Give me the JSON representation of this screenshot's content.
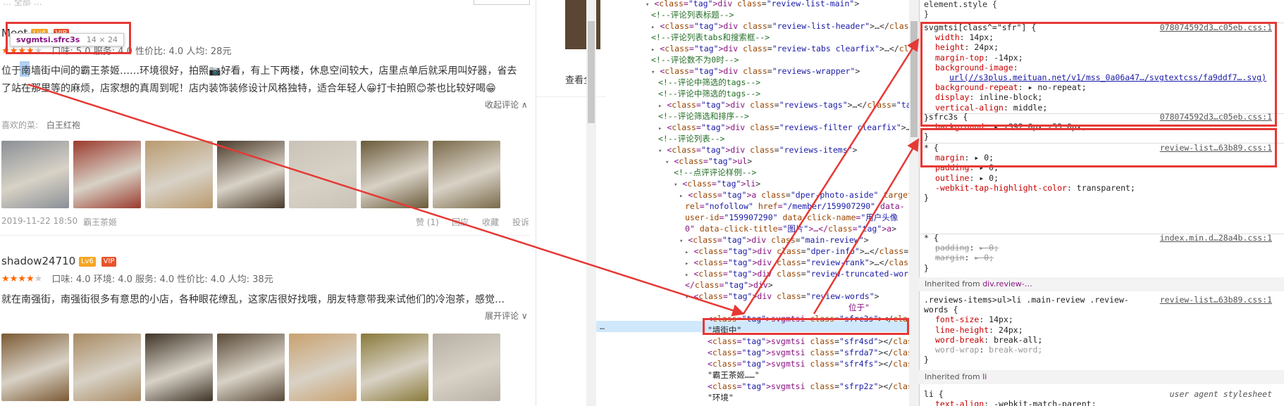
{
  "left": {
    "top_hint": "… 全部 …",
    "tooltip": {
      "name": "svgmtsi.sfrc3s",
      "size": "14 × 24"
    },
    "review1": {
      "user": "Meet",
      "level": "Lv4",
      "vip": "VIP",
      "scores": "口味: 5.0  服务: 4.0  性价比: 4.0  人均: 28元",
      "line1": "位于南墙街中间的霸王茶姬……环境很好，拍照📷好看，有上下两楼，休息空间较大，店里点单后就采用叫好器，省去",
      "line2": "了站在那里等的麻烦，店家想的真周到呢！店内装饰装修设计风格独特，适合年轻人😀打卡拍照😊茶也比较好喝😁",
      "collapse": "收起评论 ∧",
      "likes_label": "喜欢的菜:",
      "likes": "白王红袍",
      "date": "2019-11-22 18:50",
      "shop": "霸王茶姬",
      "actions": [
        "赞 (1)",
        "回应",
        "收藏",
        "投诉"
      ]
    },
    "review2": {
      "user": "shadow24710",
      "level": "Lv6",
      "vip": "VIP",
      "scores": "口味: 4.0  环境: 4.0  服务: 4.0  性价比: 4.0  人均: 38元",
      "line1": "就在南强街，南强街很多有意思的小店，各种眼花缭乱，这家店很好找哦，朋友特意带我来试他们的冷泡茶，感觉…",
      "expand": "展开评论 ∨"
    },
    "photo_colors_row1": [
      "#8a8f96",
      "#9b3a2e",
      "#b99a6f",
      "#4a3a2a",
      "#c8c2b8",
      "#6b5a3a",
      "#7a6a4a"
    ],
    "photo_colors_row2": [
      "#7c5a34",
      "#a88a62",
      "#3f3428",
      "#5a4a38",
      "#c9a16e",
      "#8a7a3a",
      "#b8b0a4"
    ]
  },
  "middle": {
    "link": "查看全"
  },
  "elements": {
    "lines": [
      "<div class=\"review-list-main\">",
      "<!--评论列表标题-->",
      "<div class=\"review-list-header\">…</div>",
      "<!--评论列表tabs和搜索框-->",
      "<div class=\"review-tabs clearfix\">…</div>",
      "<!--评论数不为0时-->",
      "<div class=\"reviews-wrapper\">",
      "<!--评论中筛选的tags-->",
      "<!--评论中筛选的tags-->",
      "<div class=\"reviews-tags\">…</div>",
      "<!--评论筛选和排序-->",
      "<div class=\"reviews-filter clearfix\">…</div>",
      "<!--评论列表-->",
      "<div class=\"reviews-items\">",
      "<ul>",
      "<!--点评评论样例-->",
      "<li>",
      "<a class=\"dper-photo-aside\" target=\"_blank\"",
      "rel=\"nofollow\" href=\"/member/159907290\" data-",
      "user-id=\"159907290\" data-click-name=\"用户头像",
      "0\" data-click-title=\"图片\">…</a>",
      "<div class=\"main-review\">",
      "<div class=\"dper-info\">…</div>",
      "<div class=\"review-rank\">…</div>",
      "<div class=\"review-truncated-words Hide\">…",
      "</div>",
      "<div class=\"review-words\">",
      "位于\"",
      "<svgmtsi class=\"sfrc3s\"></svgmtsi> == $0",
      "\"墙街中\"",
      "<svgmtsi class=\"sfr4sd\"></svgmtsi>",
      "<svgmtsi class=\"sfrda7\"></svgmtsi>",
      "<svgmtsi class=\"sfr4fs\"></svgmtsi>",
      "\"霸王茶姬……\"",
      "<svgmtsi class=\"sfrp2z\"></svgmtsi>",
      "\"环境\""
    ],
    "ellipsis": "…"
  },
  "styles": {
    "element_style": "element.style {",
    "rule1": {
      "selector": "svgmtsi[class^=\"sfr\"] {",
      "source": "078074592d3…c05eb.css:1",
      "decls": [
        [
          "width",
          "14px;"
        ],
        [
          "height",
          "24px;"
        ],
        [
          "margin-top",
          "-14px;"
        ],
        [
          "background-image",
          ""
        ],
        [
          "",
          "url(//s3plus.meituan.net/v1/mss_0a06a47…/svgtextcss/fa9ddf7….svg)"
        ],
        [
          "background-repeat",
          "▸ no-repeat;"
        ],
        [
          "display",
          "inline-block;"
        ],
        [
          "vertical-align",
          "middle;"
        ]
      ]
    },
    "rule2": {
      "selector": ".sfrc3s {",
      "source": "078074592d3…c05eb.css:1",
      "decls": [
        [
          "background",
          "▸ -392.0px -53.0px;"
        ]
      ]
    },
    "rule3": {
      "selector": "* {",
      "source": "review-list…63b89.css:1",
      "decls": [
        [
          "margin",
          "▸ 0;"
        ],
        [
          "padding",
          "▸ 0;"
        ],
        [
          "outline",
          "▸ 0;"
        ],
        [
          "-webkit-tap-highlight-color",
          "transparent;"
        ]
      ]
    },
    "rule4": {
      "selector": "* {",
      "source": "index.min.d…28a4b.css:1",
      "decls": [
        [
          "padding",
          "▸ 0;"
        ],
        [
          "margin",
          "▸ 0;"
        ]
      ]
    },
    "inherited1": "Inherited from",
    "inherited1_el": "div.review-…",
    "rule5": {
      "selector": ".reviews-items>ul>li .main-review .review-",
      "selector2": "words {",
      "source": "review-list…63b89.css:1",
      "decls": [
        [
          "font-size",
          "14px;"
        ],
        [
          "line-height",
          "24px;"
        ],
        [
          "word-break",
          "break-all;"
        ],
        [
          "word-wrap",
          "break-word;"
        ]
      ]
    },
    "inherited2": "Inherited from",
    "inherited2_el": "li",
    "rule6": {
      "selector": "li {",
      "source": "user agent stylesheet",
      "decls": [
        [
          "text-align",
          "-webkit-match-parent;"
        ]
      ]
    },
    "close": "}"
  },
  "colors": {
    "annotation_red": "#e53935",
    "vip": "#e9532b",
    "level": "#f5a623",
    "star": "#ff6600"
  }
}
